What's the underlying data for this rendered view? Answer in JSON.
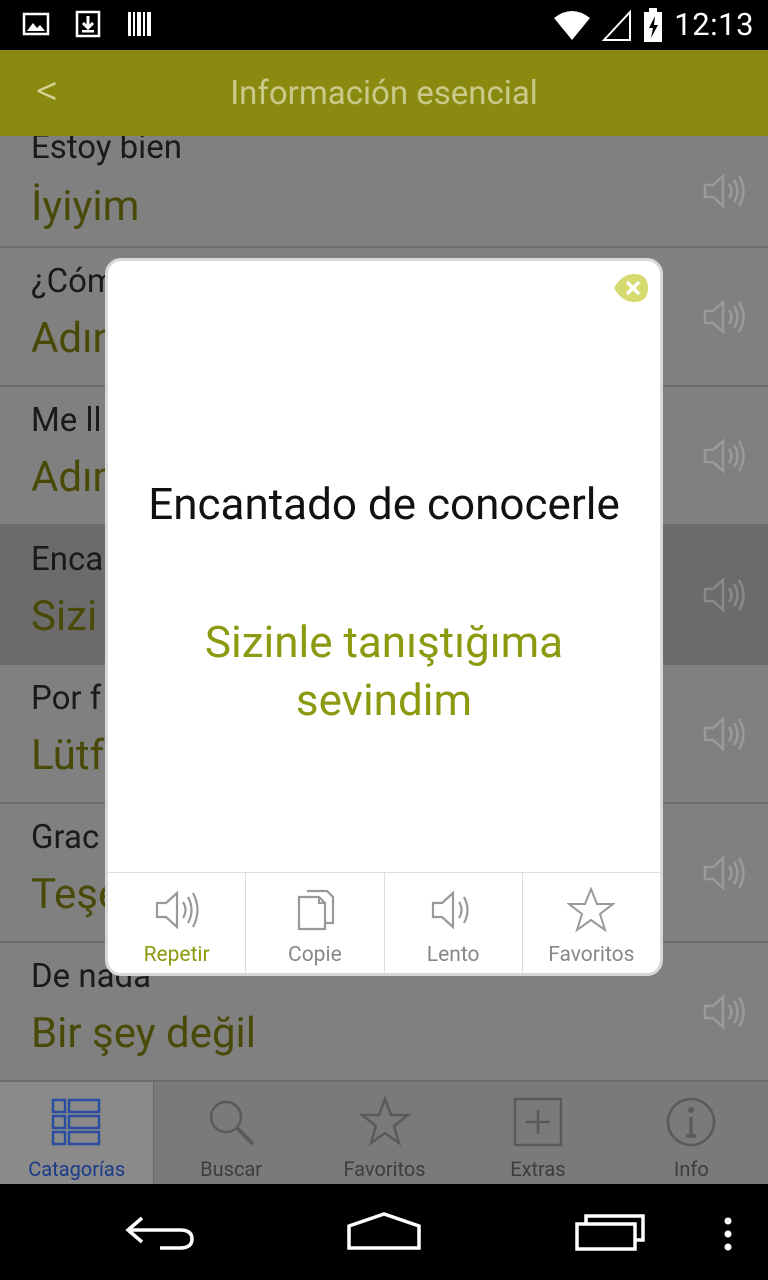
{
  "status_bar": {
    "time": "12:13",
    "left_icons": [
      "image-icon",
      "download-icon",
      "barcode-icon"
    ],
    "right_icons": [
      "wifi-icon",
      "signal-icon",
      "battery-icon"
    ]
  },
  "app_bar": {
    "back_label": "<",
    "title": "Información esencial"
  },
  "list": {
    "items": [
      {
        "es": "Estoy bien",
        "tr": "İyiyim"
      },
      {
        "es": "¿Cóm",
        "tr": "Adın"
      },
      {
        "es": "Me ll",
        "tr": "Adım"
      },
      {
        "es": "Enca",
        "tr": "Sizi"
      },
      {
        "es": "Por f",
        "tr": "Lütf"
      },
      {
        "es": "Grac",
        "tr": "Teşe"
      },
      {
        "es": "De nada",
        "tr": "Bir şey değil"
      }
    ]
  },
  "dialog": {
    "es_text": "Encantado de conocerle",
    "tr_text": "Sizinle tanıştığıma sevindim",
    "actions": [
      {
        "label": "Repetir",
        "icon": "speaker-icon"
      },
      {
        "label": "Copie",
        "icon": "copy-icon"
      },
      {
        "label": "Lento",
        "icon": "speaker-icon"
      },
      {
        "label": "Favoritos",
        "icon": "star-icon"
      }
    ]
  },
  "tabs": [
    {
      "label": "Catagorías",
      "icon": "list-icon"
    },
    {
      "label": "Buscar",
      "icon": "search-icon"
    },
    {
      "label": "Favoritos",
      "icon": "star-icon"
    },
    {
      "label": "Extras",
      "icon": "plus-icon"
    },
    {
      "label": "Info",
      "icon": "info-icon"
    }
  ],
  "colors": {
    "app_bar": "#8a8a10",
    "accent_text": "#8c9a10",
    "active_tab": "#1a3a8a"
  }
}
